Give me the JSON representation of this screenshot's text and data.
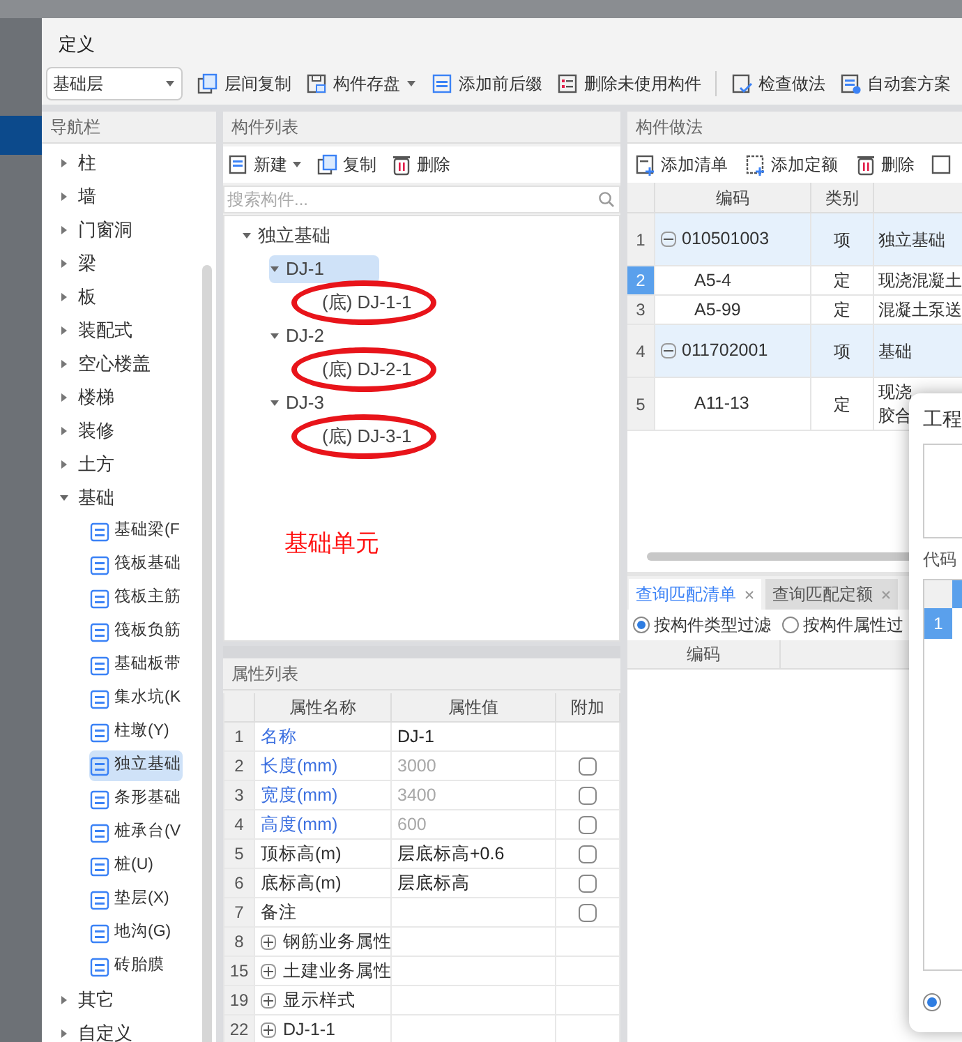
{
  "window": {
    "title": "定义"
  },
  "toolbar": {
    "floor_select": "基础层",
    "buttons": [
      {
        "label": "层间复制",
        "has_menu": false
      },
      {
        "label": "构件存盘",
        "has_menu": true
      },
      {
        "label": "添加前后缀",
        "has_menu": false
      },
      {
        "label": "删除未使用构件",
        "has_menu": false
      },
      {
        "label": "检查做法",
        "has_menu": false
      },
      {
        "label": "自动套方案",
        "has_menu": false
      }
    ]
  },
  "navigation": {
    "title": "导航栏",
    "items": [
      {
        "label": "柱",
        "expanded": false
      },
      {
        "label": "墙",
        "expanded": false
      },
      {
        "label": "门窗洞",
        "expanded": false
      },
      {
        "label": "梁",
        "expanded": false
      },
      {
        "label": "板",
        "expanded": false
      },
      {
        "label": "装配式",
        "expanded": false
      },
      {
        "label": "空心楼盖",
        "expanded": false
      },
      {
        "label": "楼梯",
        "expanded": false
      },
      {
        "label": "装修",
        "expanded": false
      },
      {
        "label": "土方",
        "expanded": false
      },
      {
        "label": "基础",
        "expanded": true,
        "children": [
          {
            "label": "基础梁(F",
            "selected": false
          },
          {
            "label": "筏板基础",
            "selected": false
          },
          {
            "label": "筏板主筋",
            "selected": false
          },
          {
            "label": "筏板负筋",
            "selected": false
          },
          {
            "label": "基础板带",
            "selected": false
          },
          {
            "label": "集水坑(K",
            "selected": false
          },
          {
            "label": "柱墩(Y)",
            "selected": false
          },
          {
            "label": "独立基础",
            "selected": true
          },
          {
            "label": "条形基础",
            "selected": false
          },
          {
            "label": "桩承台(V",
            "selected": false
          },
          {
            "label": "桩(U)",
            "selected": false
          },
          {
            "label": "垫层(X)",
            "selected": false
          },
          {
            "label": "地沟(G)",
            "selected": false
          },
          {
            "label": "砖胎膜",
            "selected": false
          }
        ]
      },
      {
        "label": "其它",
        "expanded": false
      },
      {
        "label": "自定义",
        "expanded": false
      }
    ]
  },
  "component_list": {
    "title": "构件列表",
    "buttons": [
      {
        "label": "新建",
        "has_menu": true
      },
      {
        "label": "复制",
        "has_menu": false
      },
      {
        "label": "删除",
        "has_menu": false
      }
    ],
    "search": {
      "placeholder": "搜索构件..."
    },
    "tree": [
      {
        "label": "独立基础",
        "expanded": true,
        "selected": false,
        "children": [
          {
            "label": "DJ-1",
            "expanded": true,
            "selected": true,
            "children": [
              {
                "label": "(底) DJ-1-1",
                "selected": false,
                "circled": true
              }
            ]
          },
          {
            "label": "DJ-2",
            "expanded": true,
            "selected": false,
            "children": [
              {
                "label": "(底) DJ-2-1",
                "selected": false,
                "circled": true
              }
            ]
          },
          {
            "label": "DJ-3",
            "expanded": true,
            "selected": false,
            "children": [
              {
                "label": "(底) DJ-3-1",
                "selected": false,
                "circled": true
              }
            ]
          }
        ]
      }
    ],
    "annotation": "基础单元"
  },
  "property_list": {
    "title": "属性列表",
    "columns": [
      "属性名称",
      "属性值",
      "附加"
    ],
    "rows": [
      {
        "num": "1",
        "kind": "property",
        "name": "名称",
        "value": "DJ-1",
        "name_blue": true,
        "value_dimmed": false
      },
      {
        "num": "2",
        "kind": "property",
        "name": "长度(mm)",
        "value": "3000",
        "name_blue": true,
        "value_dimmed": true,
        "checked": false
      },
      {
        "num": "3",
        "kind": "property",
        "name": "宽度(mm)",
        "value": "3400",
        "name_blue": true,
        "value_dimmed": true,
        "checked": false
      },
      {
        "num": "4",
        "kind": "property",
        "name": "高度(mm)",
        "value": "600",
        "name_blue": true,
        "value_dimmed": true,
        "checked": false
      },
      {
        "num": "5",
        "kind": "property",
        "name": "顶标高(m)",
        "value": "层底标高+0.6",
        "name_blue": false,
        "value_dimmed": false,
        "checked": false
      },
      {
        "num": "6",
        "kind": "property",
        "name": "底标高(m)",
        "value": "层底标高",
        "name_blue": false,
        "value_dimmed": false,
        "checked": false
      },
      {
        "num": "7",
        "kind": "property",
        "name": "备注",
        "name_blue": false,
        "checked": false
      },
      {
        "num": "8",
        "kind": "group",
        "name": "钢筋业务属性",
        "expanded": false
      },
      {
        "num": "15",
        "kind": "group",
        "name": "土建业务属性",
        "expanded": false
      },
      {
        "num": "19",
        "kind": "group",
        "name": "显示样式",
        "expanded": false
      },
      {
        "num": "22",
        "kind": "group",
        "name": "DJ-1-1",
        "expanded": false
      }
    ]
  },
  "methods": {
    "title": "构件做法",
    "buttons": [
      {
        "label": "添加清单"
      },
      {
        "label": "添加定额"
      },
      {
        "label": "删除"
      }
    ],
    "columns": [
      "编码",
      "类别"
    ],
    "rows": [
      {
        "num": "1",
        "kind": "item",
        "code": "010501003",
        "category": "项",
        "column_3": "独立基础",
        "expanded": true,
        "selected": false
      },
      {
        "num": "2",
        "kind": "quota",
        "code": "A5-4",
        "category": "定",
        "column_3": "现浇混凝土",
        "selected": true
      },
      {
        "num": "3",
        "kind": "quota",
        "code": "A5-99",
        "category": "定",
        "column_3": "混凝土泵送",
        "selected": false
      },
      {
        "num": "4",
        "kind": "item",
        "code": "011702001",
        "category": "项",
        "column_3": "基础",
        "expanded": true,
        "selected": false
      },
      {
        "num": "5",
        "kind": "quota",
        "code": "A11-13",
        "category": "定",
        "column_3": "现浇胶合",
        "selected": false
      }
    ]
  },
  "query": {
    "tabs": [
      {
        "label": "查询匹配清单",
        "selected": true
      },
      {
        "label": "查询匹配定额",
        "selected": false
      }
    ],
    "filters": [
      {
        "label": "按构件类型过滤",
        "selected": true
      },
      {
        "label": "按构件属性过",
        "selected": false
      }
    ],
    "columns": [
      "编码"
    ]
  },
  "dialog": {
    "title": "工程",
    "section_label": "代码",
    "rows": [
      {
        "num": "1",
        "selected": true
      }
    ],
    "option": {
      "selected": true
    }
  }
}
